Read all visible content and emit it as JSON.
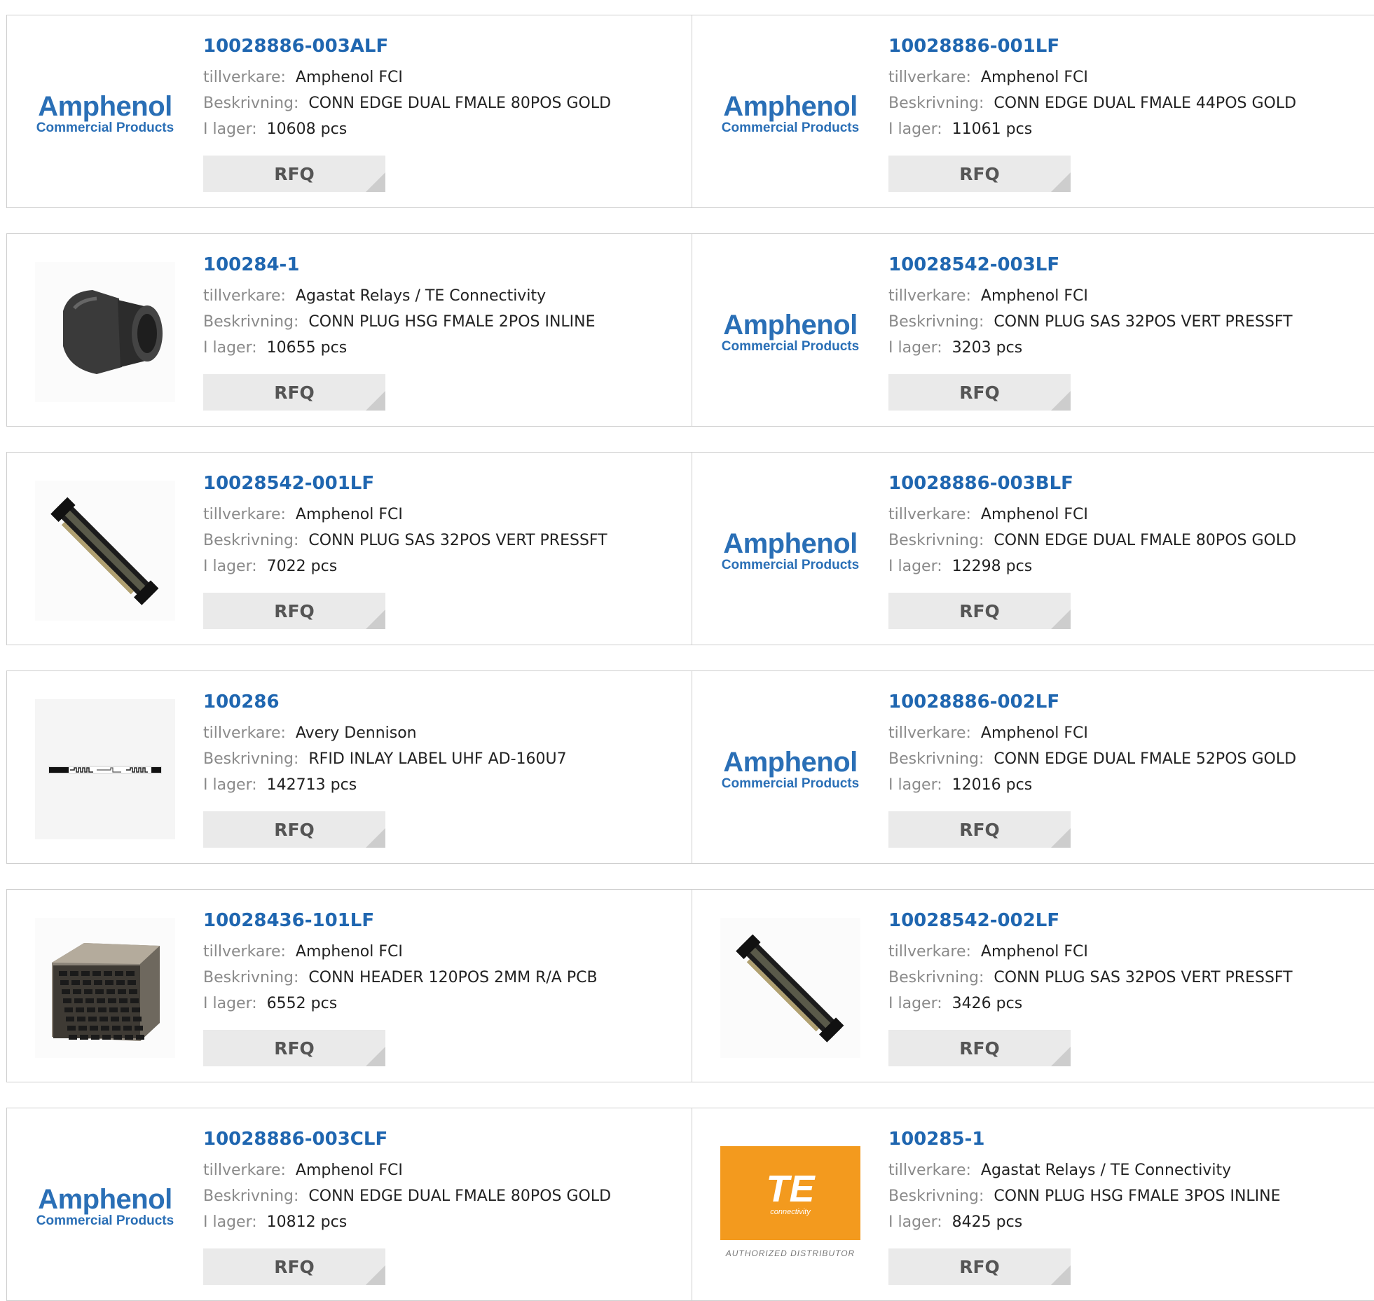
{
  "labels": {
    "manufacturer": "tillverkare:",
    "description": "Beskrivning:",
    "stock": "I lager:",
    "rfq": "RFQ"
  },
  "logos": {
    "amphenol_name": "Amphenol",
    "amphenol_sub": "Commercial Products",
    "te_mark": "TE",
    "te_sub": "connectivity",
    "te_dist": "AUTHORIZED DISTRIBUTOR"
  },
  "colors": {
    "part_link": "#1f66b0",
    "label_gray": "#8a8a8a",
    "rfq_bg": "#eaeaea",
    "border": "#cfcfcf",
    "te_orange": "#f39a1e"
  },
  "products": [
    {
      "part": "10028886-003ALF",
      "manufacturer": "Amphenol FCI",
      "description": "CONN EDGE DUAL FMALE 80POS GOLD",
      "stock": "10608 pcs",
      "image": "amphenol-logo"
    },
    {
      "part": "10028886-001LF",
      "manufacturer": "Amphenol FCI",
      "description": "CONN EDGE DUAL FMALE 44POS GOLD",
      "stock": "11061 pcs",
      "image": "amphenol-logo"
    },
    {
      "part": "100284-1",
      "manufacturer": "Agastat Relays / TE Connectivity",
      "description": "CONN PLUG HSG FMALE 2POS INLINE",
      "stock": "10655 pcs",
      "image": "round-plug-photo"
    },
    {
      "part": "10028542-003LF",
      "manufacturer": "Amphenol FCI",
      "description": "CONN PLUG SAS 32POS VERT PRESSFT",
      "stock": "3203 pcs",
      "image": "amphenol-logo"
    },
    {
      "part": "10028542-001LF",
      "manufacturer": "Amphenol FCI",
      "description": "CONN PLUG SAS 32POS VERT PRESSFT",
      "stock": "7022 pcs",
      "image": "long-connector-photo"
    },
    {
      "part": "10028886-003BLF",
      "manufacturer": "Amphenol FCI",
      "description": "CONN EDGE DUAL FMALE 80POS GOLD",
      "stock": "12298 pcs",
      "image": "amphenol-logo"
    },
    {
      "part": "100286",
      "manufacturer": "Avery Dennison",
      "description": "RFID INLAY LABEL UHF AD-160U7",
      "stock": "142713 pcs",
      "image": "rfid-inlay-photo"
    },
    {
      "part": "10028886-002LF",
      "manufacturer": "Amphenol FCI",
      "description": "CONN EDGE DUAL FMALE 52POS GOLD",
      "stock": "12016 pcs",
      "image": "amphenol-logo"
    },
    {
      "part": "10028436-101LF",
      "manufacturer": "Amphenol FCI",
      "description": "CONN HEADER 120POS 2MM R/A PCB",
      "stock": "6552 pcs",
      "image": "header-block-photo"
    },
    {
      "part": "10028542-002LF",
      "manufacturer": "Amphenol FCI",
      "description": "CONN PLUG SAS 32POS VERT PRESSFT",
      "stock": "3426 pcs",
      "image": "long-connector-photo"
    },
    {
      "part": "10028886-003CLF",
      "manufacturer": "Amphenol FCI",
      "description": "CONN EDGE DUAL FMALE 80POS GOLD",
      "stock": "10812 pcs",
      "image": "amphenol-logo"
    },
    {
      "part": "100285-1",
      "manufacturer": "Agastat Relays / TE Connectivity",
      "description": "CONN PLUG HSG FMALE 3POS INLINE",
      "stock": "8425 pcs",
      "image": "te-logo"
    }
  ]
}
